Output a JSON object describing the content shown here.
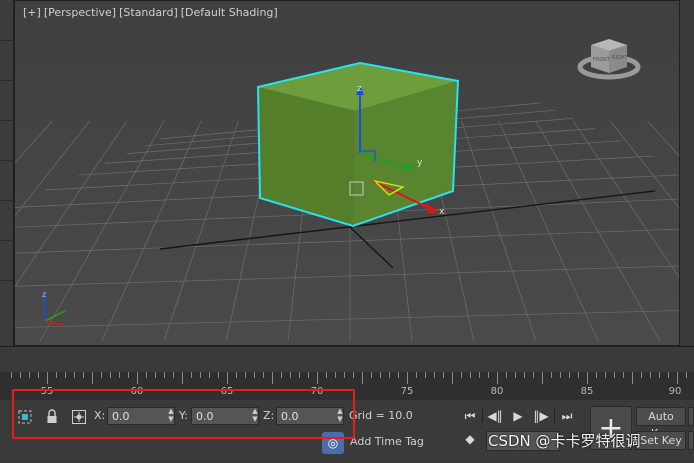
{
  "viewport": {
    "labels": [
      "[+]",
      "[Perspective]",
      "[Standard]",
      "[Default Shading]"
    ],
    "gizmo_axes": {
      "x": "x",
      "y": "y",
      "z": "z"
    },
    "viewcube_faces": {
      "front": "FRONT",
      "right": "RIGHT"
    },
    "colors": {
      "box": "#5f8d32",
      "selection": "#27e3f0",
      "x_axis": "#e01515",
      "y_axis": "#1fa01f",
      "z_axis": "#1a4fd8",
      "grid": "#6e6e6e"
    }
  },
  "timeline": {
    "ruler_numbers": [
      "55",
      "60",
      "65",
      "70",
      "75",
      "80",
      "85",
      "90"
    ]
  },
  "transform": {
    "x_label": "X:",
    "x_value": "0.0",
    "y_label": "Y:",
    "y_value": "0.0",
    "z_label": "Z:",
    "z_value": "0.0",
    "grid_text": "Grid = 10.0",
    "add_time_tag": "Add Time Tag"
  },
  "animation": {
    "auto_key": "Auto Key",
    "set_key": "Set Key"
  },
  "watermark": "CSDN @卡卡罗特很调"
}
